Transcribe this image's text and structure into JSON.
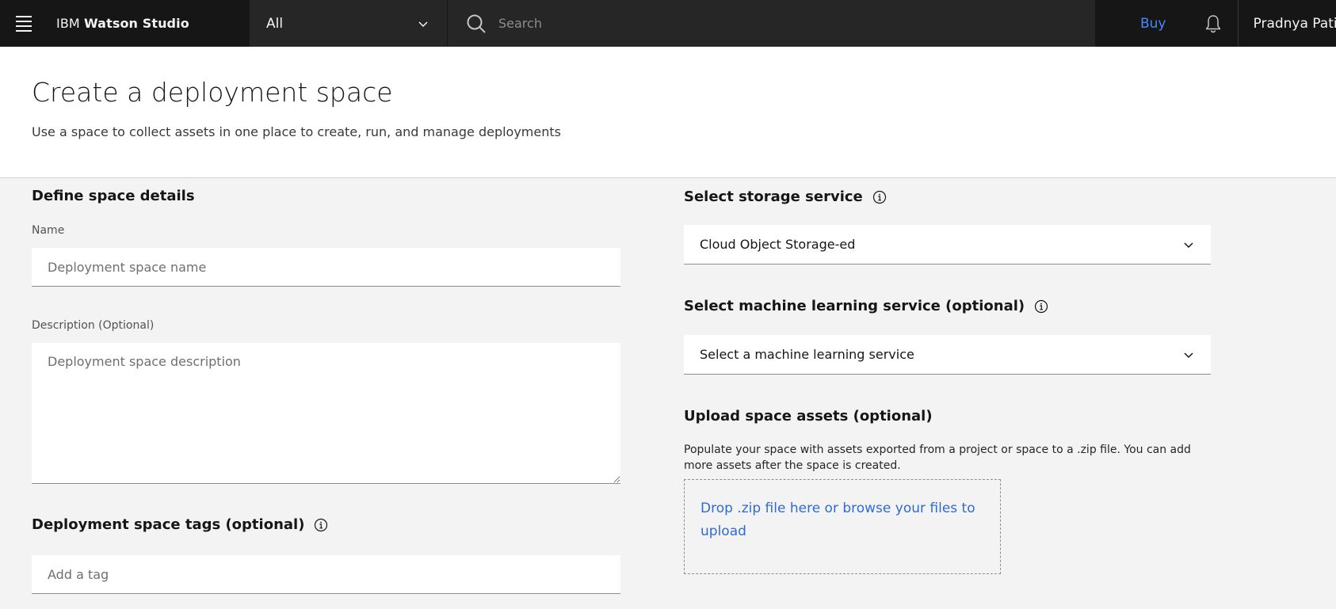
{
  "header": {
    "brand_prefix": "IBM ",
    "brand_name": "Watson Studio",
    "scope_selected": "All",
    "search_placeholder": "Search",
    "buy_label": "Buy",
    "user_name": "Pradnya Patil'"
  },
  "page": {
    "title": "Create a deployment space",
    "subtitle": "Use a space to collect assets in one place to create, run, and manage deployments"
  },
  "details": {
    "heading": "Define space details",
    "name_label": "Name",
    "name_placeholder": "Deployment space name",
    "description_label": "Description (Optional)",
    "description_placeholder": "Deployment space description",
    "tags_heading": "Deployment space tags (optional)",
    "tags_placeholder": "Add a tag"
  },
  "storage": {
    "heading": "Select storage service",
    "selected": "Cloud Object Storage-ed"
  },
  "ml": {
    "heading": "Select machine learning service (optional)",
    "selected": "Select a machine learning service"
  },
  "upload": {
    "heading": "Upload space assets (optional)",
    "description": "Populate your space with assets exported from a project or space to a .zip file. You can add more assets after the space is created.",
    "dropzone_text": "Drop .zip file here or browse your files to upload"
  },
  "colors": {
    "topbar": "#262626",
    "topbar_dark": "#161616",
    "link": "#4589ff",
    "dropzone_link": "#2f6bd8",
    "background": "#f3f3f3"
  },
  "icons": [
    "menu-icon",
    "chevron-down-icon",
    "search-icon",
    "notification-bell-icon",
    "info-icon"
  ]
}
